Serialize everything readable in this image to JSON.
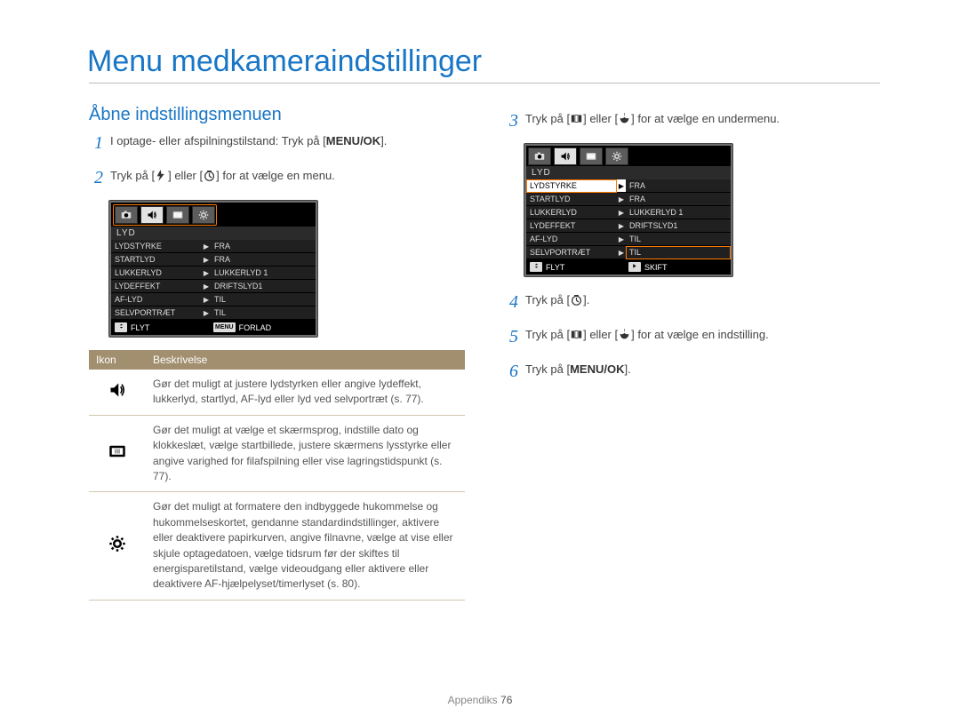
{
  "title": "Menu medkameraindstillinger",
  "section_title": "Åbne indstillingsmenuen",
  "steps_left": [
    {
      "num": "1",
      "parts": [
        {
          "t": "I optage- eller afspilningstilstand: Tryk på ["
        },
        {
          "b": "MENU/OK"
        },
        {
          "t": "]."
        }
      ]
    },
    {
      "num": "2",
      "parts": [
        {
          "t": "Tryk på ["
        },
        {
          "icon": "flash"
        },
        {
          "t": "] eller ["
        },
        {
          "icon": "timer"
        },
        {
          "t": "] for at vælge en menu."
        }
      ]
    }
  ],
  "steps_right": [
    {
      "num": "3",
      "parts": [
        {
          "t": "Tryk på ["
        },
        {
          "icon": "disp"
        },
        {
          "t": "] eller ["
        },
        {
          "icon": "macro"
        },
        {
          "t": "] for at vælge en undermenu."
        }
      ]
    },
    {
      "num": "4",
      "parts": [
        {
          "t": "Tryk på ["
        },
        {
          "icon": "timer"
        },
        {
          "t": "]."
        }
      ]
    },
    {
      "num": "5",
      "parts": [
        {
          "t": "Tryk på ["
        },
        {
          "icon": "disp"
        },
        {
          "t": "] eller ["
        },
        {
          "icon": "macro"
        },
        {
          "t": "] for at vælge en indstilling."
        }
      ]
    },
    {
      "num": "6",
      "parts": [
        {
          "t": "Tryk på ["
        },
        {
          "b": "MENU/OK"
        },
        {
          "t": "]."
        }
      ]
    }
  ],
  "lcd": {
    "tabs": [
      "camera",
      "sound",
      "display",
      "gear"
    ],
    "title": "LYD",
    "rows": [
      {
        "label": "LYDSTYRKE",
        "val": "FRA"
      },
      {
        "label": "STARTLYD",
        "val": "FRA"
      },
      {
        "label": "LUKKERLYD",
        "val": "LUKKERLYD 1"
      },
      {
        "label": "LYDEFFEKT",
        "val": "DRIFTSLYD1"
      },
      {
        "label": "AF-LYD",
        "val": "TIL"
      },
      {
        "label": "SELVPORTRÆT",
        "val": "TIL"
      }
    ],
    "foot_left_label": "FLYT",
    "left": {
      "sel_tab": 1,
      "tabbar_highlight": true,
      "sel_row": -1,
      "row_highlight": -1,
      "val_highlight": -1,
      "foot_right_icon": "menu",
      "foot_right_label": "FORLAD"
    },
    "right": {
      "sel_tab": 1,
      "tabbar_highlight": false,
      "sel_row": 0,
      "row_highlight": 0,
      "val_highlight": 5,
      "foot_right_icon": "right",
      "foot_right_label": "SKIFT"
    }
  },
  "table": {
    "head_icon": "Ikon",
    "head_desc": "Beskrivelse",
    "rows": [
      {
        "icon": "sound",
        "desc": "Gør det muligt at justere lydstyrken eller angive lydeffekt, lukkerlyd, startlyd, AF-lyd eller lyd ved selvportræt (s. 77)."
      },
      {
        "icon": "display",
        "desc": "Gør det muligt at vælge et skærmsprog, indstille dato og klokkeslæt, vælge startbillede, justere skærmens lysstyrke eller angive varighed for filafspilning eller vise lagringstidspunkt (s. 77)."
      },
      {
        "icon": "gear",
        "desc": "Gør det muligt at formatere den indbyggede hukommelse og hukommelseskortet, gendanne standardindstillinger, aktivere eller deaktivere papirkurven, angive filnavne, vælge at vise eller skjule optagedatoen, vælge tidsrum før der skiftes til energisparetilstand, vælge videoudgang eller aktivere eller deaktivere AF-hjælpelyset/timerlyset (s. 80)."
      }
    ]
  },
  "footer": {
    "label": "Appendiks",
    "page": "76"
  }
}
